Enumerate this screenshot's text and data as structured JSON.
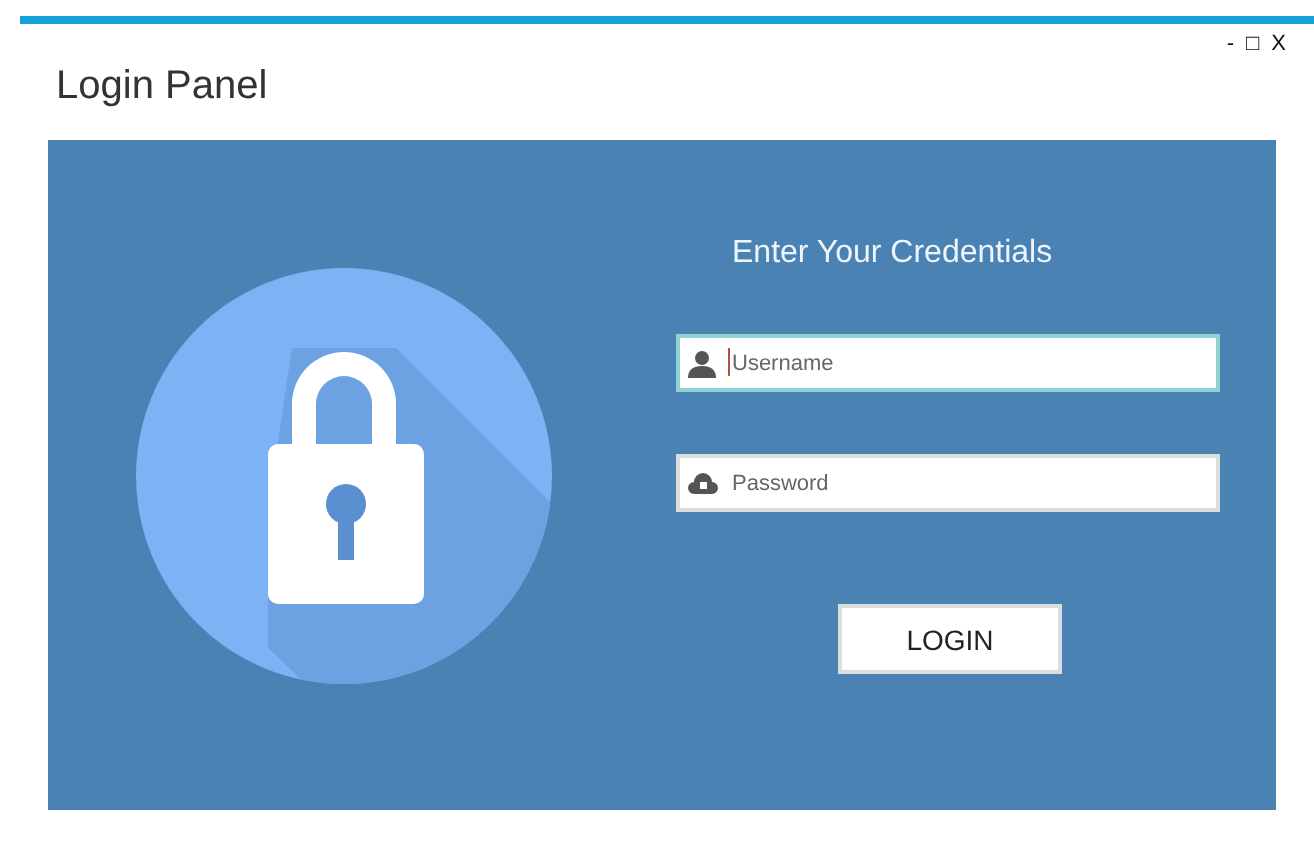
{
  "window": {
    "title": "Login Panel",
    "controls": [
      "-",
      "□",
      "X"
    ]
  },
  "form": {
    "heading": "Enter Your Credentials",
    "fields": [
      {
        "kind": "user",
        "placeholder": "Username",
        "focused": true
      },
      {
        "kind": "password",
        "placeholder": "Password",
        "focused": false
      }
    ],
    "button": "LOGIN"
  }
}
